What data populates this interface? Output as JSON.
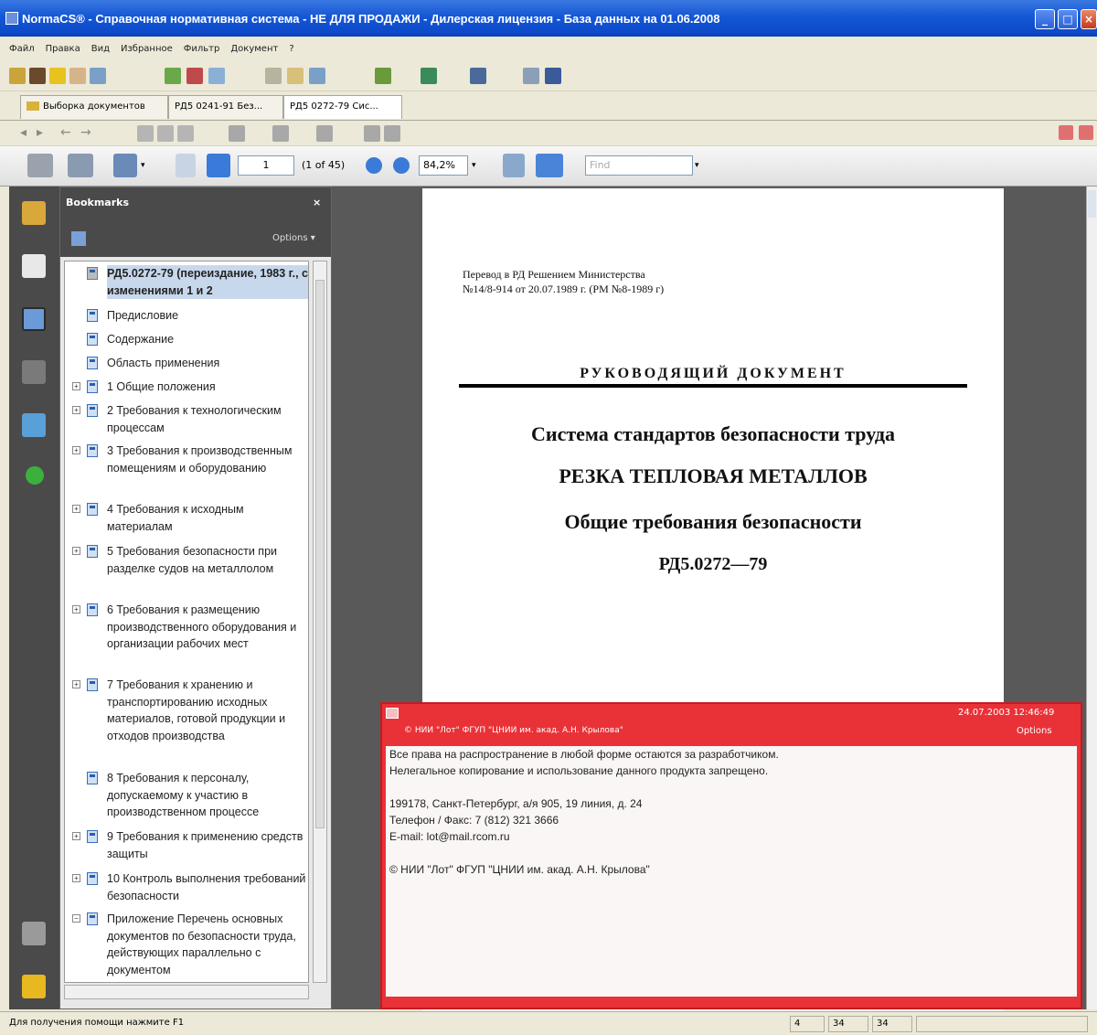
{
  "window": {
    "title": "NormaCS® - Справочная нормативная система - НЕ ДЛЯ ПРОДАЖИ - Дилерская лицензия - База данных на 01.06.2008"
  },
  "menu": [
    "Файл",
    "Правка",
    "Вид",
    "Избранное",
    "Фильтр",
    "Документ",
    "?"
  ],
  "tabs": [
    "Выборка документов",
    "РД5 0241-91 Без...",
    "РД5 0272-79 Сис..."
  ],
  "viewer": {
    "page_value": "1",
    "page_count": "(1 of 45)",
    "zoom": "84,2%",
    "find_placeholder": "Find"
  },
  "bookmarks": {
    "title": "Bookmarks",
    "options": "Options",
    "close": "×",
    "items": [
      {
        "label": "РД5.0272-79 (переиздание, 1983 г., с изменениями 1 и 2"
      },
      {
        "label": "Предисловие"
      },
      {
        "label": "Содержание"
      },
      {
        "label": "Область применения"
      },
      {
        "label": "1 Общие положения"
      },
      {
        "label": "2 Требования к технологическим процессам"
      },
      {
        "label": "3 Требования к производственным помещениям и оборудованию"
      },
      {
        "label": "4 Требования к исходным материалам"
      },
      {
        "label": "5 Требования безопасности при разделке судов на металлолом"
      },
      {
        "label": "6 Требования к размещению производственного оборудования и организации рабочих мест"
      },
      {
        "label": "7 Требования к хранению и транспортированию исходных материалов, готовой продукции и отходов производства"
      },
      {
        "label": "8 Требования к персоналу, допускаемому к участию в производственном процессе"
      },
      {
        "label": "9 Требования к применению средств защиты"
      },
      {
        "label": "10 Контроль выполнения требований безопасности"
      },
      {
        "label": "Приложение Перечень основных документов по безопасности труда, действующих параллельно с документом"
      }
    ]
  },
  "document": {
    "transfer_line1": "Перевод в РД Решением Министерства",
    "transfer_line2": "№14/8-914 от 20.07.1989 г. (РМ №8-1989 г)",
    "doc_kind": "РУКОВОДЯЩИЙ ДОКУМЕНТ",
    "series": "Система стандартов безопасности труда",
    "title": "РЕЗКА ТЕПЛОВАЯ МЕТАЛЛОВ",
    "subtitle": "Общие требования безопасности",
    "code": "РД5.0272—79"
  },
  "note": {
    "timestamp": "24.07.2003 12:46:49",
    "author": "© НИИ \"Лот\" ФГУП \"ЦНИИ им. акад. А.Н. Крылова\"",
    "options": "Options",
    "lines": [
      "Все права на распространение в любой форме остаются за разработчиком.",
      "Нелегальное копирование и использование данного продукта запрещено.",
      "",
      "199178, Санкт-Петербург, а/я 905, 19 линия, д. 24",
      "Телефон / Факс: 7 (812) 321 3666",
      "E-mail: lot@mail.rcom.ru",
      "",
      "© НИИ \"Лот\" ФГУП \"ЦНИИ им. акад. А.Н. Крылова\""
    ]
  },
  "status": {
    "help": "Для получения помощи нажмите F1",
    "a": "4",
    "b": "34",
    "c": "34"
  }
}
